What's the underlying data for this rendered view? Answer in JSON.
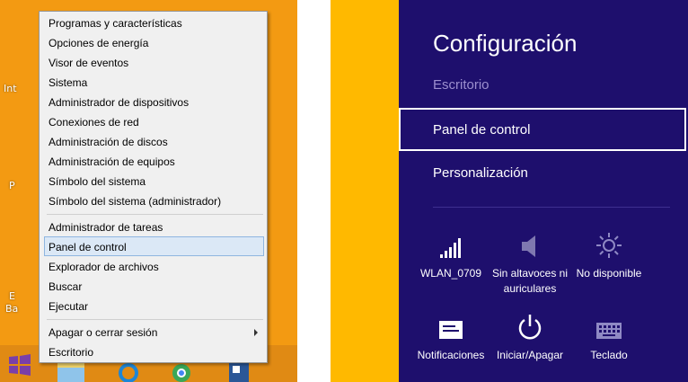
{
  "context_menu": {
    "group1": [
      "Programas y características",
      "Opciones de energía",
      "Visor de eventos",
      "Sistema",
      "Administrador de dispositivos",
      "Conexiones de red",
      "Administración de discos",
      "Administración de equipos",
      "Símbolo del sistema",
      "Símbolo del sistema (administrador)"
    ],
    "group2": [
      "Administrador de tareas",
      "Panel de control",
      "Explorador de archivos",
      "Buscar",
      "Ejecutar"
    ],
    "group3": [
      "Apagar o cerrar sesión",
      "Escritorio"
    ],
    "highlighted_item": "Panel de control"
  },
  "desktop": {
    "fragments": [
      "Int",
      "P",
      "E",
      "Ba"
    ]
  },
  "settings_charm": {
    "title": "Configuración",
    "context": "Escritorio",
    "links": [
      "Panel de control",
      "Personalización"
    ],
    "selected_link": "Panel de control",
    "tiles": [
      {
        "icon": "wifi-signal-icon",
        "label": "WLAN_0709"
      },
      {
        "icon": "speaker-muted-icon",
        "label": "Sin altavoces ni auriculares"
      },
      {
        "icon": "brightness-icon",
        "label": "No disponible"
      },
      {
        "icon": "notifications-icon",
        "label": "Notificaciones"
      },
      {
        "icon": "power-icon",
        "label": "Iniciar/Apagar"
      },
      {
        "icon": "keyboard-icon",
        "label": "Teclado"
      }
    ]
  },
  "colors": {
    "desktop_bg": "#f39a12",
    "charm_bg": "#1e0f6d",
    "charm_accent_bg": "#ffb900",
    "menu_bg": "#f0f0f0",
    "menu_highlight": "#dbe8f6"
  }
}
